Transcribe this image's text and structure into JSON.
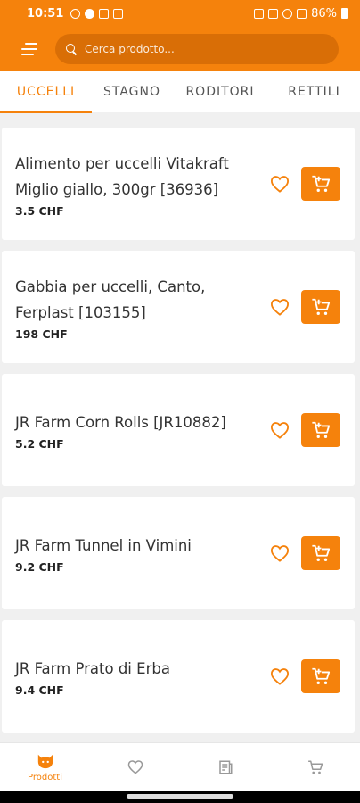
{
  "status_bar": {
    "time": "10:51",
    "battery": "86%"
  },
  "search": {
    "placeholder": "Cerca prodotto..."
  },
  "tabs": [
    {
      "label": "UCCELLI",
      "active": true
    },
    {
      "label": "STAGNO",
      "active": false
    },
    {
      "label": "RODITORI",
      "active": false
    },
    {
      "label": "RETTILI",
      "active": false
    }
  ],
  "products": [
    {
      "name": "Alimento per uccelli Vitakraft Miglio giallo, 300gr [36936]",
      "price": "3.5 CHF"
    },
    {
      "name": "Gabbia per uccelli, Canto, Ferplast [103155]",
      "price": "198 CHF"
    },
    {
      "name": "JR Farm Corn Rolls [JR10882]",
      "price": "5.2 CHF"
    },
    {
      "name": "JR Farm Tunnel in Vimini",
      "price": "9.2 CHF"
    },
    {
      "name": "JR Farm Prato di Erba",
      "price": "9.4 CHF"
    }
  ],
  "bottom_nav": [
    {
      "label": "Prodotti",
      "icon": "cat-icon",
      "active": true
    },
    {
      "label": "",
      "icon": "heart-icon",
      "active": false
    },
    {
      "label": "",
      "icon": "document-icon",
      "active": false
    },
    {
      "label": "",
      "icon": "cart-icon",
      "active": false
    }
  ],
  "colors": {
    "accent": "#f5820c",
    "search_bg": "#d96e06",
    "background": "#f0f0f0"
  }
}
